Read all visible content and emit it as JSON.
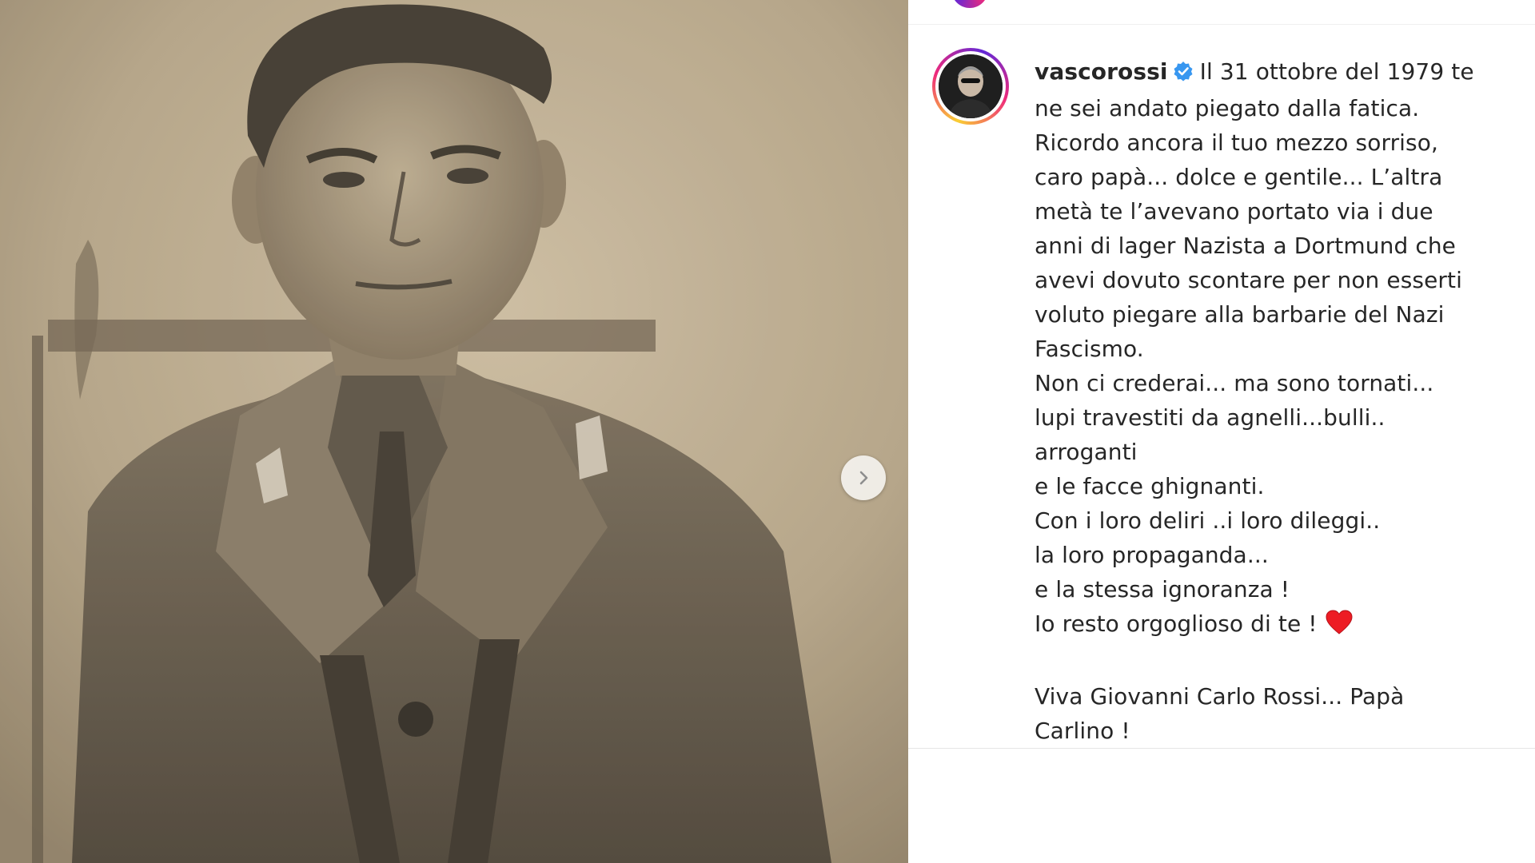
{
  "post": {
    "username": "vascorossi",
    "verified": true,
    "caption_lines": [
      "Il 31 ottobre del 1979 te",
      "ne sei andato piegato dalla fatica.",
      "Ricordo ancora il tuo mezzo sorriso,",
      "caro papà... dolce e gentile... L’altra",
      "metà te l’avevano portato via i due",
      "anni di lager Nazista a Dortmund che",
      "avevi dovuto scontare per non esserti",
      "voluto piegare alla barbarie del Nazi",
      "Fascismo.",
      "Non ci crederai... ma sono tornati...",
      "lupi travestiti da agnelli...bulli..",
      "arroganti",
      "e le facce ghignanti.",
      "Con i loro deliri ..i loro dileggi..",
      "la loro propaganda...",
      "e la stessa ignoranza !",
      "Io resto orgoglioso di te !",
      "",
      "Viva Giovanni Carlo Rossi... Papà",
      "Carlino !"
    ],
    "caption_emoji": "red-heart-icon"
  },
  "media": {
    "description_icon": "vintage-sepia-photo",
    "next_icon": "chevron-right-icon"
  },
  "colors": {
    "verified_badge": "#3897f0",
    "heart": "#ed1c24",
    "text": "#262626",
    "sepia_bg": "#b7a78c"
  }
}
